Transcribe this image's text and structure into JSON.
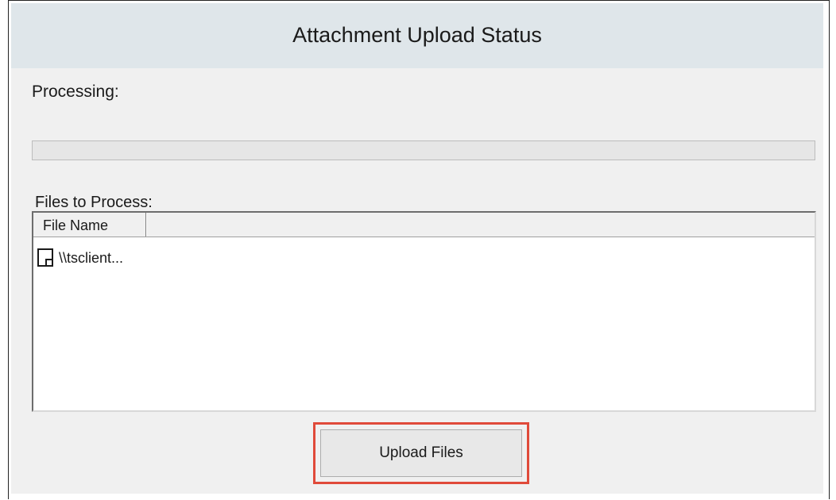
{
  "dialog": {
    "title": "Attachment Upload Status",
    "processing_label": "Processing:",
    "progress_percent": 0,
    "files_label": "Files to Process:"
  },
  "listview": {
    "columns": [
      "File Name",
      ""
    ],
    "rows": [
      {
        "icon": "file-icon",
        "name": "\\\\tsclient..."
      }
    ]
  },
  "buttons": {
    "upload_label": "Upload Files"
  },
  "colors": {
    "highlight": "#e04a3a",
    "titlebar": "#dfe6ea",
    "client": "#f0f0f0"
  }
}
